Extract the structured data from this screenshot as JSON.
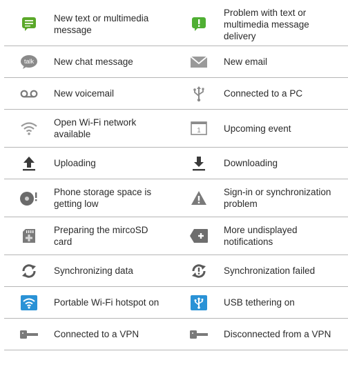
{
  "rows": [
    {
      "left": {
        "icon": "new-message-icon",
        "label": "New text or multimedia message"
      },
      "right": {
        "icon": "message-error-icon",
        "label": "Problem with text or multimedia message delivery"
      }
    },
    {
      "left": {
        "icon": "talk-chat-icon",
        "label": "New chat message"
      },
      "right": {
        "icon": "email-envelope-icon",
        "label": "New email"
      }
    },
    {
      "left": {
        "icon": "voicemail-icon",
        "label": "New voicemail"
      },
      "right": {
        "icon": "usb-icon",
        "label": "Connected to a PC"
      }
    },
    {
      "left": {
        "icon": "open-wifi-icon",
        "label": "Open Wi-Fi network available"
      },
      "right": {
        "icon": "calendar-icon",
        "label": "Upcoming event"
      }
    },
    {
      "left": {
        "icon": "upload-arrow-icon",
        "label": "Uploading"
      },
      "right": {
        "icon": "download-arrow-icon",
        "label": "Downloading"
      }
    },
    {
      "left": {
        "icon": "storage-low-icon",
        "label": "Phone storage space is getting low"
      },
      "right": {
        "icon": "warning-triangle-icon",
        "label": "Sign-in or synchronization problem"
      }
    },
    {
      "left": {
        "icon": "sd-card-icon",
        "label": "Preparing the mircoSD card"
      },
      "right": {
        "icon": "more-notifications-icon",
        "label": "More undisplayed notifications"
      }
    },
    {
      "left": {
        "icon": "sync-icon",
        "label": "Synchronizing data"
      },
      "right": {
        "icon": "sync-failed-icon",
        "label": "Synchronization failed"
      }
    },
    {
      "left": {
        "icon": "wifi-hotspot-icon",
        "label": "Portable Wi-Fi hotspot on"
      },
      "right": {
        "icon": "usb-tethering-icon",
        "label": "USB tethering on"
      }
    },
    {
      "left": {
        "icon": "vpn-key-icon",
        "label": "Connected to a VPN"
      },
      "right": {
        "icon": "vpn-key-disconnected-icon",
        "label": "Disconnected from a VPN"
      }
    }
  ]
}
